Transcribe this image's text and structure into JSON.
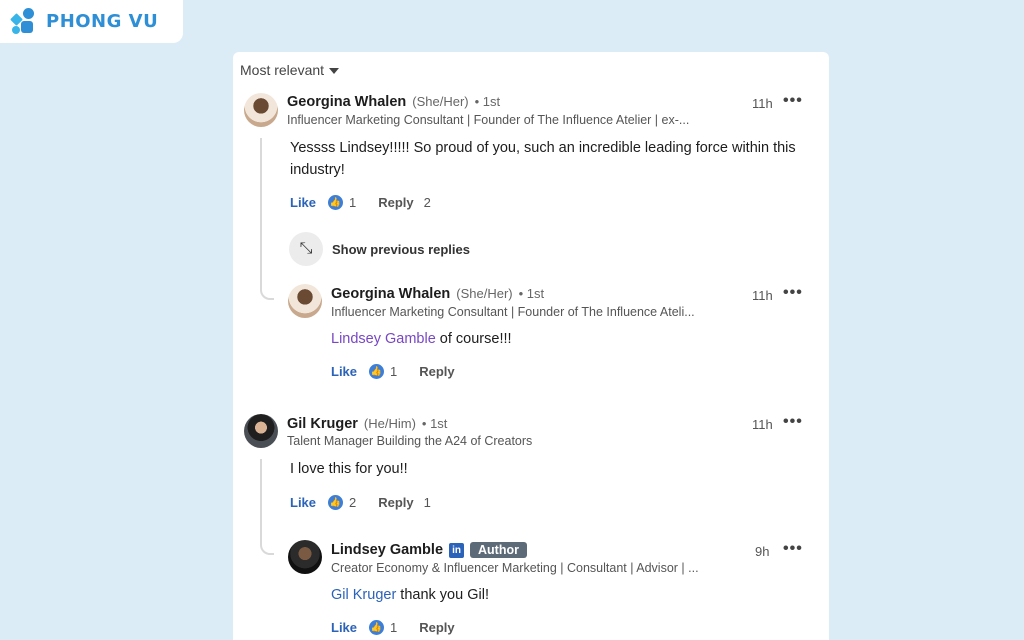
{
  "brand": {
    "name": "PHONG VU"
  },
  "sort": {
    "label": "Most relevant"
  },
  "comments": [
    {
      "name": "Georgina Whalen",
      "pronouns": "(She/Her)",
      "degree": "• 1st",
      "headline": "Influencer Marketing Consultant | Founder of The Influence Atelier | ex-...",
      "time": "11h",
      "text": "Yessss Lindsey!!!!! So proud of you, such an incredible leading force within this industry!",
      "like_label": "Like",
      "like_count": "1",
      "reply_label": "Reply",
      "reply_count": "2",
      "show_previous": "Show previous replies",
      "reply": {
        "name": "Georgina Whalen",
        "pronouns": "(She/Her)",
        "degree": "• 1st",
        "headline": "Influencer Marketing Consultant | Founder of The Influence Ateli...",
        "time": "11h",
        "mention": "Lindsey Gamble",
        "text": " of course!!!",
        "like_label": "Like",
        "like_count": "1",
        "reply_label": "Reply"
      }
    },
    {
      "name": "Gil Kruger",
      "pronouns": "(He/Him)",
      "degree": "• 1st",
      "headline": "Talent Manager Building the A24 of Creators",
      "time": "11h",
      "text": "I love this for you!!",
      "like_label": "Like",
      "like_count": "2",
      "reply_label": "Reply",
      "reply_count": "1",
      "reply": {
        "name": "Lindsey Gamble",
        "linkedin_badge": "in",
        "author_badge": "Author",
        "headline": "Creator Economy & Influencer Marketing | Consultant | Advisor | ...",
        "time": "9h",
        "mention": "Gil Kruger",
        "text": " thank you Gil!",
        "like_label": "Like",
        "like_count": "1",
        "reply_label": "Reply"
      }
    }
  ],
  "icons": {
    "more": "more-horizontal-icon",
    "like": "thumbs-up-icon",
    "expand": "expand-arrows-icon",
    "sort_caret": "caret-down-icon"
  },
  "colors": {
    "background": "#dcecf6",
    "brand": "#2e8fd6",
    "link": "#2b63b8",
    "mention_purple": "#7847c4",
    "author_badge": "#5d6b78"
  }
}
